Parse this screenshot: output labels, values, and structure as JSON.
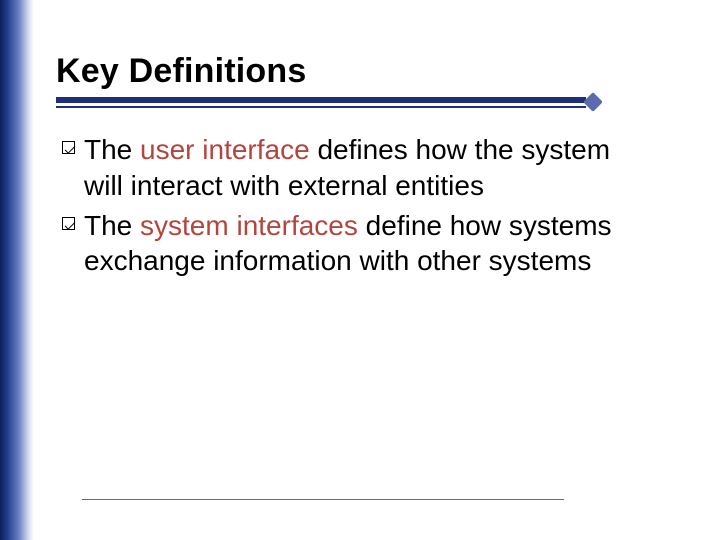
{
  "colors": {
    "accent_navy": "#1f2f7a",
    "emphasis_red": "#b4453d",
    "left_gradient_dark": "#0d1f5a"
  },
  "title": "Key Definitions",
  "bullets": [
    {
      "pre": "The ",
      "em": "user interface",
      "post": " defines how the system will interact with external entities"
    },
    {
      "pre": "The ",
      "em": "system interfaces",
      "post": " define how systems exchange information with other systems"
    }
  ]
}
